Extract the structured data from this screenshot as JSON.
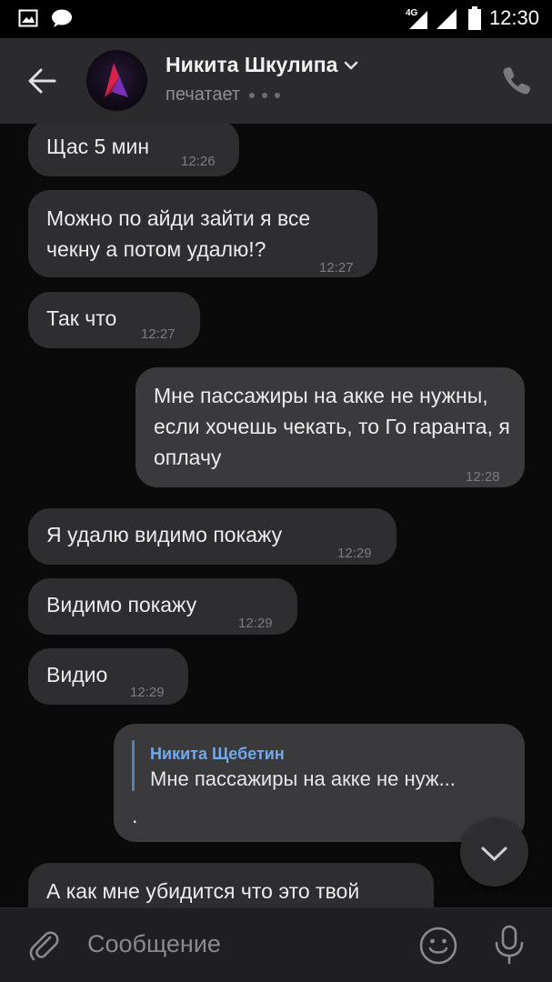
{
  "status_bar": {
    "network": "4G",
    "time": "12:30"
  },
  "header": {
    "contact_name": "Никита Шкулипа",
    "status": "печатает"
  },
  "messages": [
    {
      "direction": "in",
      "text": "Щас 5 мин",
      "time": "12:26"
    },
    {
      "direction": "in",
      "text": "Можно по айди зайти я все чекну а потом удалю!?",
      "time": "12:27"
    },
    {
      "direction": "in",
      "text": "Так что",
      "time": "12:27"
    },
    {
      "direction": "out",
      "text": "Мне пассажиры на акке не нужны, если хочешь чекать, то Го гаранта, я оплачу",
      "time": "12:28"
    },
    {
      "direction": "in",
      "text": "Я удалю видимо покажу",
      "time": "12:29"
    },
    {
      "direction": "in",
      "text": "Видимо покажу",
      "time": "12:29"
    },
    {
      "direction": "in",
      "text": "Видио",
      "time": "12:29"
    },
    {
      "direction": "out",
      "reply_to_name": "Никита Щебетин",
      "reply_to_text": "Мне пассажиры на акке не нуж...",
      "text": "."
    },
    {
      "direction": "in",
      "text": "А как мне убидится что это твой"
    }
  ],
  "composer": {
    "placeholder": "Сообщение"
  },
  "colors": {
    "header_bg": "#2b2b2d",
    "bubble_in": "#2e2e30",
    "bubble_out": "#3a3a3c",
    "accent": "#71aaeb"
  },
  "icons": [
    "image-icon",
    "chat-bubble-icon",
    "signal-icon",
    "battery-icon",
    "back-arrow-icon",
    "chevron-down-icon",
    "phone-icon",
    "scroll-down-icon",
    "attach-icon",
    "emoji-icon",
    "mic-icon"
  ]
}
